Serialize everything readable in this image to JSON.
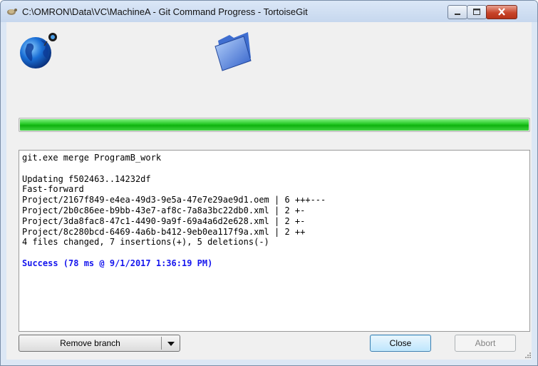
{
  "window": {
    "title": "C:\\OMRON\\Data\\VC\\MachineA - Git Command Progress - TortoiseGit"
  },
  "progress": {
    "value": 1.0,
    "color": "#16c016"
  },
  "log": {
    "lines": [
      {
        "text": "git.exe merge ProgramB_work",
        "style": "normal"
      },
      {
        "text": "",
        "style": "normal"
      },
      {
        "text": "Updating f502463..14232df",
        "style": "normal"
      },
      {
        "text": "Fast-forward",
        "style": "normal"
      },
      {
        "text": "Project/2167f849-e4ea-49d3-9e5a-47e7e29ae9d1.oem | 6 +++---",
        "style": "normal"
      },
      {
        "text": "Project/2b0c86ee-b9bb-43e7-af8c-7a8a3bc22db0.xml | 2 +-",
        "style": "normal"
      },
      {
        "text": "Project/3da8fac8-47c1-4490-9a9f-69a4a6d2e628.xml | 2 +-",
        "style": "normal"
      },
      {
        "text": "Project/8c280bcd-6469-4a6b-b412-9eb0ea117f9a.xml | 2 ++",
        "style": "normal"
      },
      {
        "text": "4 files changed, 7 insertions(+), 5 deletions(-)",
        "style": "normal"
      },
      {
        "text": "",
        "style": "normal"
      },
      {
        "text": "Success (78 ms @ 9/1/2017 1:36:19 PM)",
        "style": "success"
      }
    ]
  },
  "buttons": {
    "remove_branch": "Remove branch",
    "close": "Close",
    "abort": "Abort"
  },
  "icons": {
    "title": "tortoisegit-icon",
    "globe": "globe-icon",
    "folder": "folder-icon"
  },
  "colors": {
    "success_text": "#1515ee",
    "progress_green": "#16c016"
  }
}
